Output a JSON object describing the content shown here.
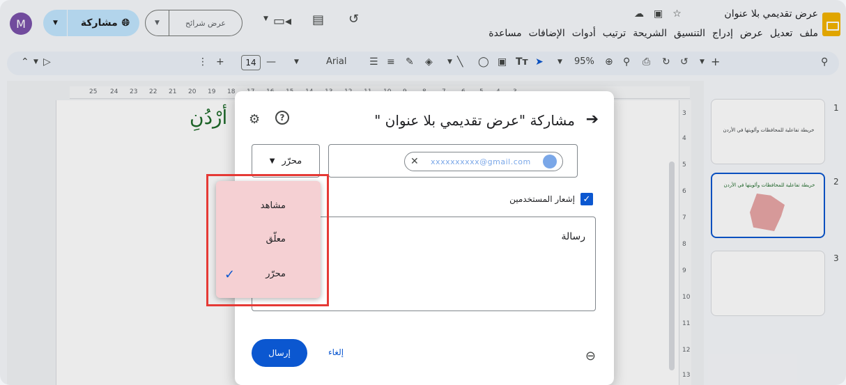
{
  "app": {
    "doc_title": "عرض تقديمي بلا عنوان",
    "menu": [
      "ملف",
      "تعديل",
      "عرض",
      "إدراج",
      "التنسيق",
      "الشريحة",
      "ترتيب",
      "أدوات",
      "الإضافات",
      "مساعدة"
    ],
    "avatar_letter": "M",
    "share_label": "مشاركة",
    "slideshow_label": "عرض شرائح"
  },
  "toolbar": {
    "font_name": "Arial",
    "font_size": "14",
    "zoom": "95%"
  },
  "ruler": {
    "top_ticks": [
      "25",
      "24",
      "23",
      "22",
      "21",
      "20",
      "19",
      "18",
      "17",
      "16",
      "15",
      "14",
      "13",
      "12",
      "11",
      "10",
      "9",
      "8",
      "7",
      "6",
      "5",
      "4",
      "3"
    ],
    "side_ticks": [
      "3",
      "4",
      "5",
      "6",
      "7",
      "8",
      "9",
      "10",
      "11",
      "12",
      "13"
    ]
  },
  "slide": {
    "title_fragment": "أرْدُنِ"
  },
  "filmstrip": {
    "slides": [
      {
        "num": "1",
        "text": "خريطة تفاعلية للمحافظات وألويتها في الأردن"
      },
      {
        "num": "2",
        "text": "خريطة تفاعلية للمحافظات وألويتها في الأردن"
      },
      {
        "num": "3",
        "text": ""
      }
    ]
  },
  "dialog": {
    "title": "مشاركة \"عرض تقديمي بلا عنوان \"",
    "role_selected": "محرّر",
    "chip_email": "xxxxxxxxxx@gmail.com",
    "notify_label": "إشعار المستخدمين",
    "message_placeholder": "رسالة",
    "cancel_label": "إلغاء",
    "send_label": "إرسال"
  },
  "role_menu": {
    "items": [
      "مشاهد",
      "معلّق",
      "محرّر"
    ],
    "checked_index": 2
  },
  "colors": {
    "accent": "#0b57d0",
    "share_bg": "#c2e7ff",
    "highlight": "#e53935",
    "dropdown_bg": "#f5d0d3",
    "slide_title": "#1e6b2a"
  }
}
